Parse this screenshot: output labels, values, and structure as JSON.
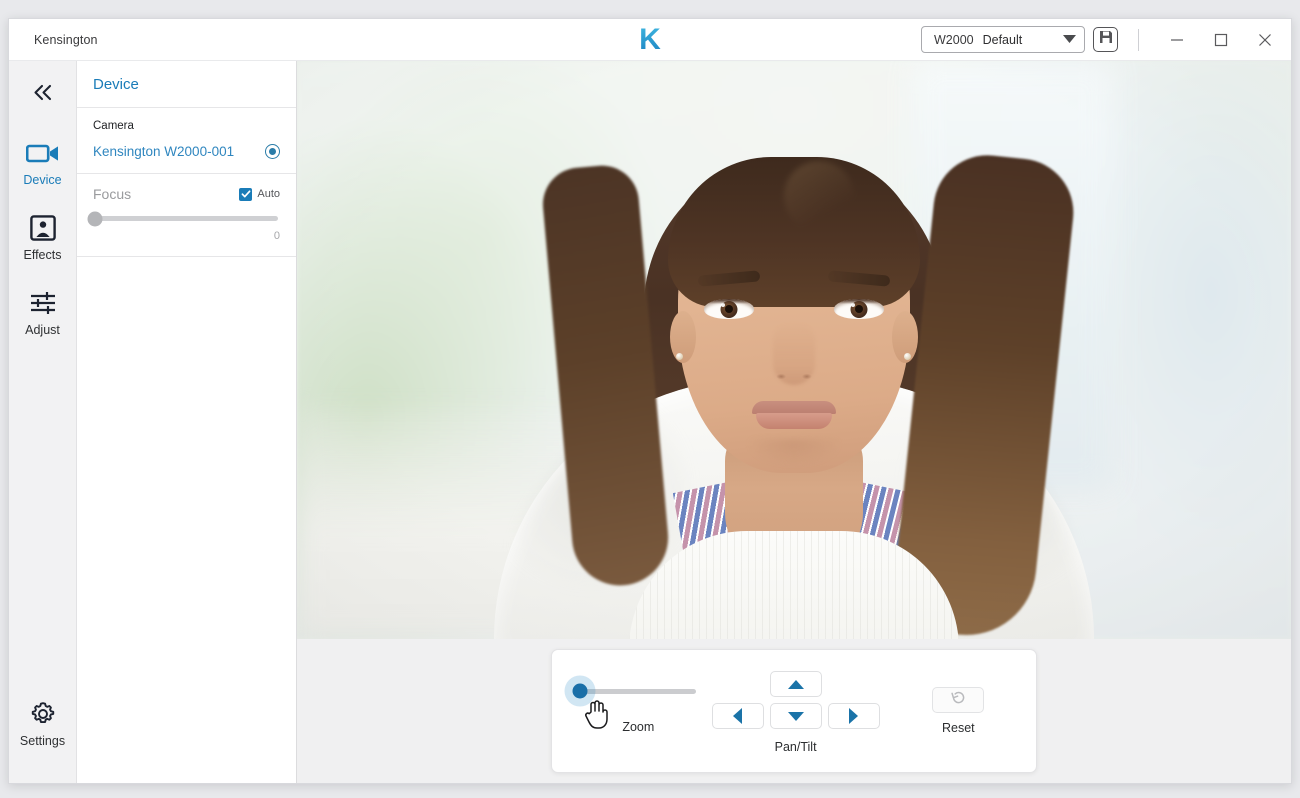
{
  "window": {
    "app_name": "Kensington",
    "logo_text": "K"
  },
  "titlebar": {
    "preset": {
      "model": "W2000",
      "name": "Default",
      "caret_icon": "chevron-down-icon"
    },
    "save_preset_icon": "save-disk-icon",
    "minimize_icon": "minimize-icon",
    "maximize_icon": "maximize-icon",
    "close_icon": "close-icon"
  },
  "sidebar": {
    "collapse_icon": "double-chevron-left-icon",
    "items": [
      {
        "label": "Device",
        "icon": "video-camera-icon",
        "active": true
      },
      {
        "label": "Effects",
        "icon": "portrait-frame-icon",
        "active": false
      },
      {
        "label": "Adjust",
        "icon": "sliders-icon",
        "active": false
      }
    ],
    "settings": {
      "label": "Settings",
      "icon": "gear-icon"
    }
  },
  "device_panel": {
    "title": "Device",
    "camera": {
      "section_label": "Camera",
      "name": "Kensington W2000-001",
      "selected": true
    },
    "focus": {
      "label": "Focus",
      "auto_label": "Auto",
      "auto_checked": true,
      "value": "0",
      "slider_percent": 0,
      "disabled": true
    }
  },
  "ptz": {
    "zoom": {
      "caption": "Zoom",
      "value_percent": 0
    },
    "pan_tilt": {
      "caption": "Pan/Tilt",
      "up_icon": "triangle-up-icon",
      "down_icon": "triangle-down-icon",
      "left_icon": "triangle-left-icon",
      "right_icon": "triangle-right-icon"
    },
    "reset": {
      "caption": "Reset",
      "icon": "rotate-ccw-icon",
      "disabled": true
    }
  },
  "colors": {
    "accent_blue": "#1a7cb8",
    "control_blue": "#1a73a8",
    "link_blue": "#2f86bf",
    "rail_bg": "#f2f2f3"
  }
}
